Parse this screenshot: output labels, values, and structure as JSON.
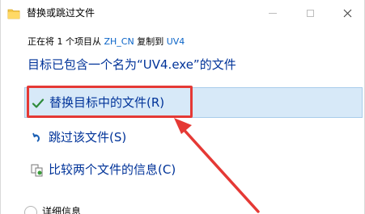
{
  "window": {
    "title": "替换或跳过文件",
    "icon": "folder-icon",
    "accent_color": "#0a64c8"
  },
  "transfer": {
    "prefix": "正在将 1 个项目从 ",
    "source": "ZH_CN",
    "middle": " 复制到 ",
    "destination": "UV4"
  },
  "conflict_message": "目标已包含一个名为“UV4.exe”的文件",
  "options": {
    "replace": {
      "label": "替换目标中的文件(R)",
      "icon": "checkmark-icon",
      "selected": true
    },
    "skip": {
      "label": "跳过该文件(S)",
      "icon": "skip-icon"
    },
    "compare": {
      "label": "比较两个文件的信息(C)",
      "icon": "compare-icon"
    }
  },
  "details": {
    "label": "详细信息",
    "icon": "chevron-circle-icon"
  },
  "annotation": {
    "color": "#e53935"
  }
}
